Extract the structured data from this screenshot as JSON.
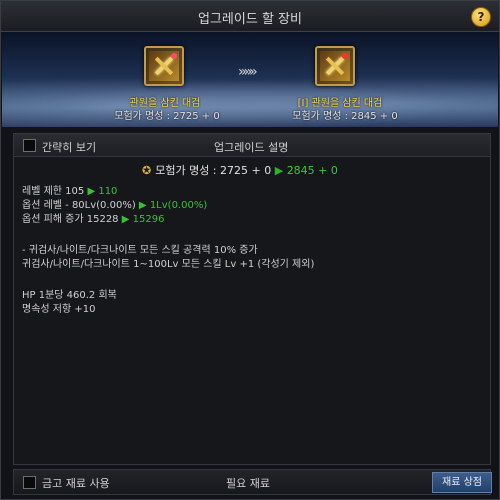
{
  "window": {
    "title": "업그레이드 할 장비",
    "help_label": "?"
  },
  "banner": {
    "arrows": "»»»",
    "source": {
      "name": "관원을 삼킨 대검",
      "rank_label": "모험가 명성 : 2725 + 0"
    },
    "target": {
      "name": "[I] 관원을 삼킨 대검",
      "rank_label": "모험가 명성 : 2845 + 0"
    }
  },
  "panel": {
    "simple_view_label": "간략히 보기",
    "title": "업그레이드 설명",
    "rank_line": {
      "label": "모험가 명성 : 2725 + 0",
      "arrow": "▶",
      "new_value": "2845 + 0"
    },
    "lines": [
      {
        "old": "레벨 제한 105",
        "arrow": "▶",
        "new": "110"
      },
      {
        "old": "옵션 레벨 - 80Lv(0.00%)",
        "arrow": "▶",
        "new": "1Lv(0.00%)"
      },
      {
        "old": "옵션 피해 증가 15228",
        "arrow": "▶",
        "new": "15296"
      }
    ],
    "desc": [
      "- 귀검사/나이트/다크나이트 모든 스킬 공격력 10% 증가",
      "귀검사/나이트/다크나이트 1~100Lv 모든 스킬 Lv +1 (각성기 제외)",
      "HP 1분당 460.2 회복",
      "명속성 저항 +10"
    ]
  },
  "footer": {
    "use_bank_label": "금고 재료 사용",
    "title": "필요 재료",
    "shop_button": "재료 상점"
  },
  "colors": {
    "accent_green": "#39c639",
    "item_name": "#f3d54a",
    "button_blue": "#3d5d8c"
  }
}
